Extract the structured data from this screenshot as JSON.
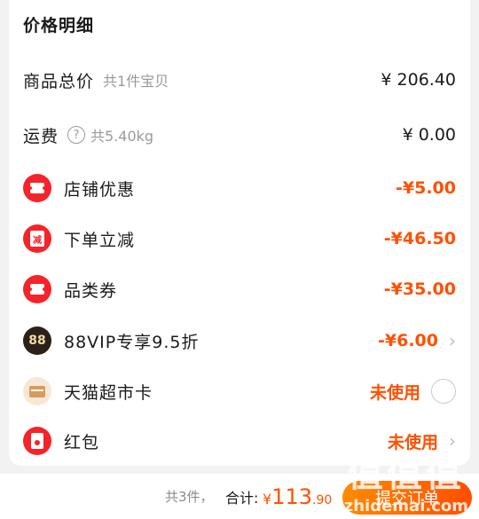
{
  "header": {
    "title": "价格明细"
  },
  "rows": {
    "goods": {
      "label": "商品总价",
      "sub": "共1件宝贝",
      "amount": "¥ 206.40"
    },
    "shipping": {
      "label": "运费",
      "sub": "共5.40kg",
      "amount": "¥ 0.00"
    },
    "shop_discount": {
      "label": "店铺优惠",
      "amount": "-¥5.00"
    },
    "order_cut": {
      "label": "下单立减",
      "icon_text": "减",
      "amount": "-¥46.50"
    },
    "category_coupon": {
      "label": "品类券",
      "amount": "-¥35.00"
    },
    "vip88": {
      "label": "88VIP专享9.5折",
      "icon_text": "88",
      "amount": "-¥6.00"
    },
    "tmall_card": {
      "label": "天猫超市卡",
      "status": "未使用"
    },
    "red_packet": {
      "label": "红包",
      "status": "未使用"
    }
  },
  "footer": {
    "count": "共3件，",
    "total_label": "合计:",
    "total_yen": "¥",
    "total_int": "113",
    "total_dec": ".90",
    "submit": "提交订单"
  },
  "watermark": {
    "big": "值值值",
    "small": "zhidemai.com"
  },
  "colors": {
    "accent": "#ff5000",
    "icon_red": "#f5232a",
    "vip_dark": "#2b2118"
  }
}
